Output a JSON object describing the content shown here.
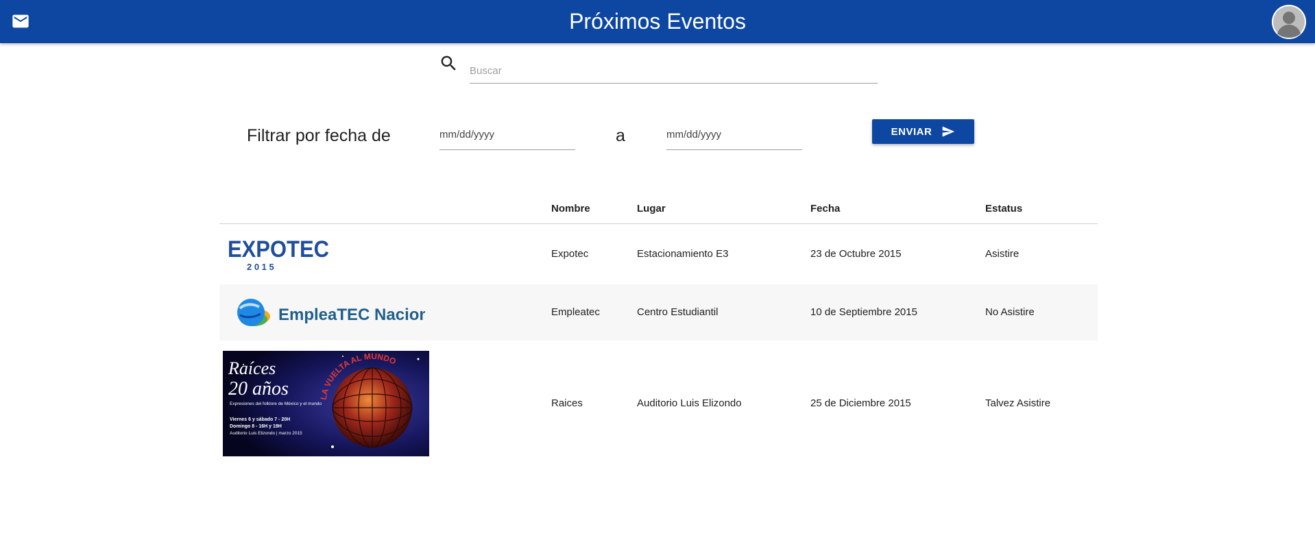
{
  "header": {
    "title": "Próximos Eventos",
    "mail_icon": "mail-icon",
    "avatar_icon": "user-avatar"
  },
  "search": {
    "placeholder": "Buscar",
    "value": "",
    "icon": "search-icon"
  },
  "filter": {
    "label": "Filtrar por fecha de",
    "from_placeholder": "mm/dd/yyyy",
    "separator": "a",
    "to_placeholder": "mm/dd/yyyy",
    "submit_label": "ENVIAR",
    "submit_icon": "send-icon"
  },
  "table": {
    "headers": [
      "",
      "Nombre",
      "Lugar",
      "Fecha",
      "Estatus"
    ],
    "rows": [
      {
        "logo": {
          "text": "EXPOTEC",
          "subtext": "2 0 1 5"
        },
        "nombre": "Expotec",
        "lugar": "Estacionamiento E3",
        "fecha": "23 de Octubre 2015",
        "estatus": "Asistire"
      },
      {
        "logo": {
          "text": "EmpleaTEC Nacional"
        },
        "nombre": "Empleatec",
        "lugar": "Centro Estudiantil",
        "fecha": "10 de Septiembre 2015",
        "estatus": "No Asistire"
      },
      {
        "logo": {
          "title_line1": "Raíces",
          "title_line2": "20 años",
          "subtitle": "Expresiones del folklore de México y el mundo",
          "schedule_line1": "Viernes 6 y sábado 7 - 20H",
          "schedule_line2": "Domingo 8 - 16H y 19H",
          "venue": "Auditorio Luis Elizondo  |  marzo 2015",
          "arc_text": "LA VUELTA AL MUNDO"
        },
        "nombre": "Raices",
        "lugar": "Auditorio Luis Elizondo",
        "fecha": "25 de Diciembre 2015",
        "estatus": "Talvez Asistire"
      }
    ]
  },
  "colors": {
    "primary": "#0d47a1",
    "row_stripe": "#f7f7f7",
    "text": "#212121"
  }
}
